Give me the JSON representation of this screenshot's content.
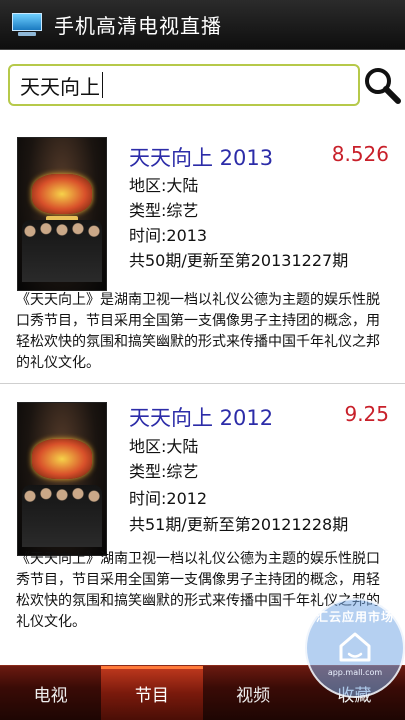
{
  "app": {
    "title": "手机高清电视直播",
    "icon": "tv-icon"
  },
  "search": {
    "value": "天天向上",
    "button_icon": "search-icon"
  },
  "results": [
    {
      "title": "天天向上 2013",
      "score": "8.526",
      "region": "地区:大陆",
      "genre": "类型:综艺",
      "time": "时间:2013",
      "episodes": "共50期/更新至第20131227期",
      "description": "《天天向上》是湖南卫视一档以礼仪公德为主题的娱乐性脱口秀节目，节目采用全国第一支偶像男子主持团的概念，用轻松欢快的氛围和搞笑幽默的形式来传播中国千年礼仪之邦的礼仪文化。",
      "poster_label": "天天向上"
    },
    {
      "title": "天天向上 2012",
      "score": "9.25",
      "region": "地区:大陆",
      "genre": "类型:综艺",
      "time": "时间:2012",
      "episodes": "共51期/更新至第20121228期",
      "description": "《天天向上》湖南卫视一档以礼仪公德为主题的娱乐性脱口秀节目，节目采用全国第一支偶像男子主持团的概念，用轻松欢快的氛围和搞笑幽默的形式来传播中国千年礼仪之邦的礼仪文化。",
      "poster_label": "天天向上"
    }
  ],
  "nav": {
    "tabs": [
      {
        "label": "电视"
      },
      {
        "label": "节目"
      },
      {
        "label": "视频"
      },
      {
        "label": "收藏"
      }
    ],
    "active_index": 1
  },
  "watermark": {
    "text": "汇云应用市场",
    "url": "app.mall.com",
    "icon": "cloud-house-icon"
  },
  "colors": {
    "title_blue": "#2c2ca8",
    "score_red": "#c8202a",
    "search_border": "#b6c94a",
    "nav_active": "#c23a1e"
  }
}
